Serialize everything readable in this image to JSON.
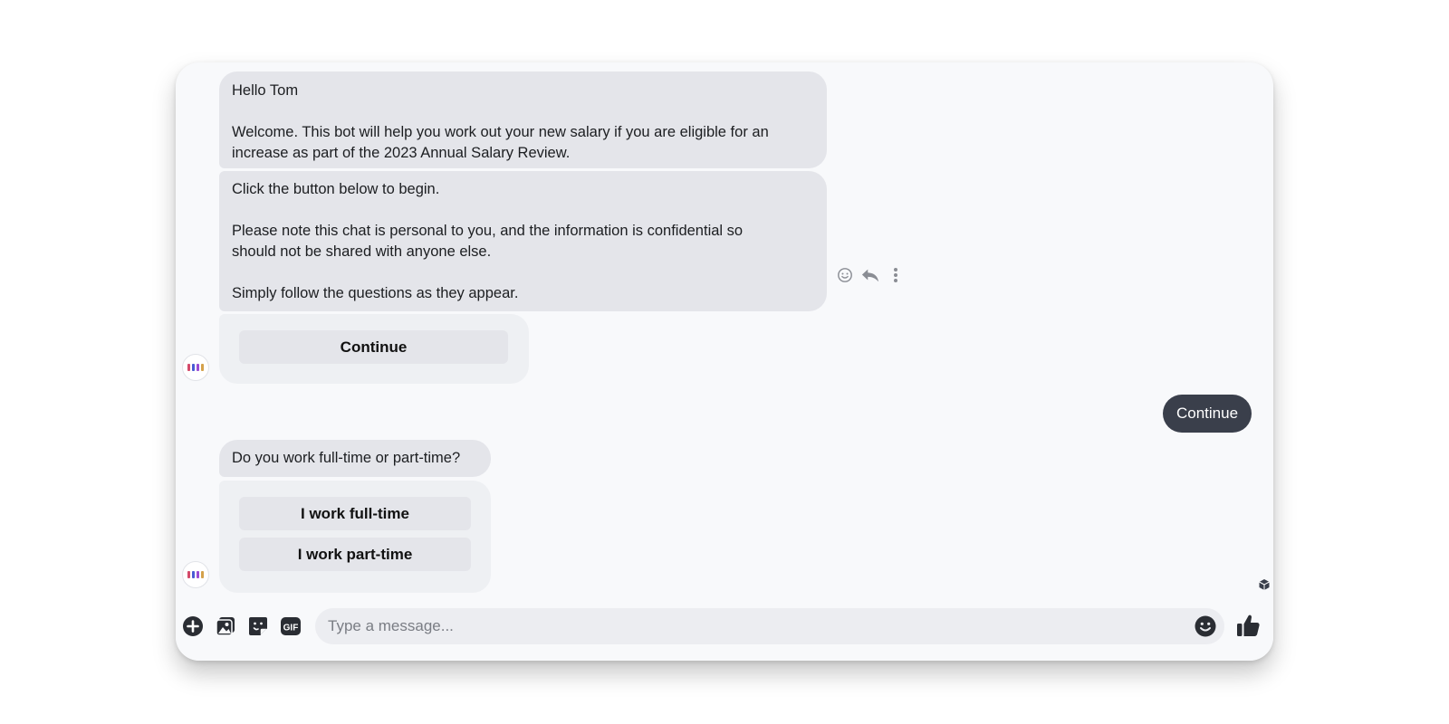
{
  "messages": {
    "greeting_lines": [
      "Hello Tom",
      "",
      "Welcome. This bot will help you work out your new salary if you are eligible for an",
      "increase as part of the 2023 Annual Salary Review."
    ],
    "instructions_lines": [
      "Click the button below to begin.",
      "",
      "Please note this chat is personal to you, and the information is confidential so",
      "should not be shared with anyone else.",
      "",
      "Simply follow the questions as they appear."
    ],
    "continue_button": "Continue",
    "user_reply": "Continue",
    "question": "Do you work full-time or part-time?",
    "option_full_time": "I work full-time",
    "option_part_time": "I work part-time"
  },
  "message_actions": {
    "react_icon": "smiley-icon",
    "reply_icon": "reply-icon",
    "more_icon": "more-vertical-icon"
  },
  "composer": {
    "placeholder": "Type a message...",
    "gif_label": "GIF",
    "tools": [
      "add-icon",
      "image-icon",
      "sticker-icon",
      "gif-icon"
    ],
    "emoji_icon": "emoji-icon",
    "like_icon": "thumbs-up-icon"
  },
  "colors": {
    "window_bg": "#f8f9fb",
    "bot_bubble": "#e4e5ea",
    "user_bubble": "#3a3f4b",
    "icon_dark": "#2a2d33"
  }
}
